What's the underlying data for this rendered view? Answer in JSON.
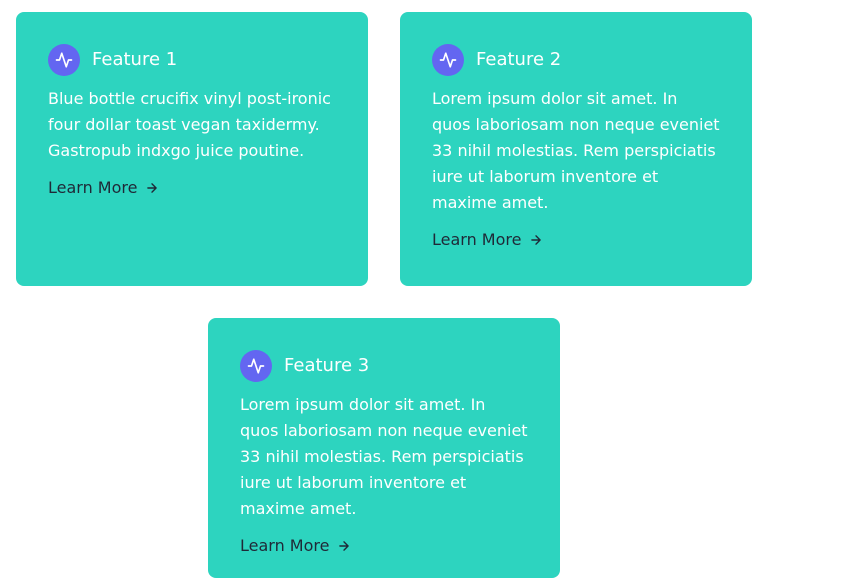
{
  "colors": {
    "card_background": "#2dd4bf",
    "icon_background": "#6366f1",
    "title_text": "#ffffff",
    "link_text": "#1f2937"
  },
  "cards": [
    {
      "icon": "activity-pulse-icon",
      "title": "Feature 1",
      "body": "Blue bottle crucifix vinyl post-ironic four dollar toast vegan taxidermy. Gastropub indxgo juice poutine.",
      "link_label": "Learn More",
      "link_icon": "arrow-right-icon"
    },
    {
      "icon": "activity-pulse-icon",
      "title": "Feature 2",
      "body": "Lorem ipsum dolor sit amet. In quos laboriosam non neque eveniet 33 nihil molestias. Rem perspiciatis iure ut laborum inventore et maxime amet.",
      "link_label": "Learn More",
      "link_icon": "arrow-right-icon"
    },
    {
      "icon": "activity-pulse-icon",
      "title": "Feature 3",
      "body": "Lorem ipsum dolor sit amet. In quos laboriosam non neque eveniet 33 nihil molestias. Rem perspiciatis iure ut laborum inventore et maxime amet.",
      "link_label": "Learn More",
      "link_icon": "arrow-right-icon"
    }
  ]
}
